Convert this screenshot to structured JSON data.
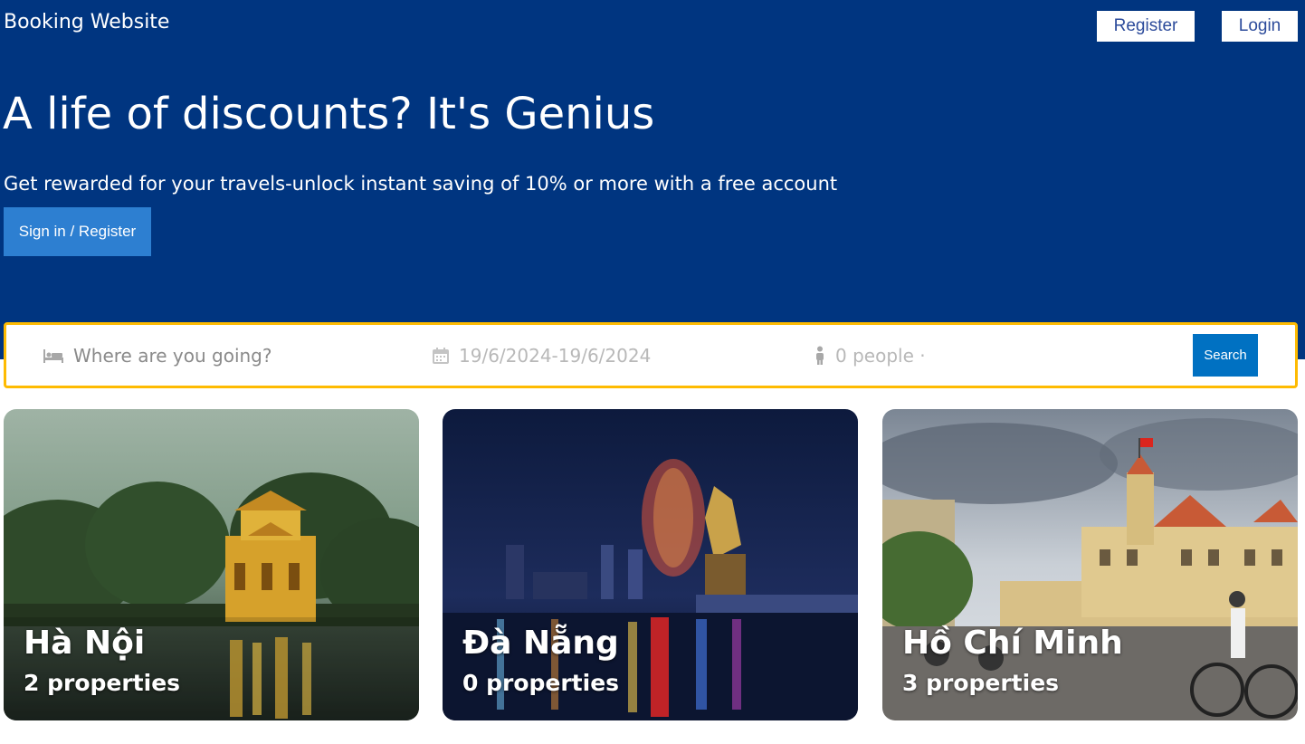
{
  "header": {
    "brand": "Booking Website",
    "register_label": "Register",
    "login_label": "Login"
  },
  "hero": {
    "title": "A life of discounts? It's Genius",
    "subtitle": "Get rewarded for your travels-unlock instant saving of 10% or more with a free account",
    "cta_label": "Sign in / Register"
  },
  "search": {
    "destination_placeholder": "Where are you going?",
    "date_range": "19/6/2024-19/6/2024",
    "people": "0 people ·",
    "search_label": "Search",
    "icons": {
      "destination": "bed-icon",
      "date": "calendar-icon",
      "people": "person-icon"
    }
  },
  "destinations": [
    {
      "city": "Hà Nội",
      "properties": "2 properties"
    },
    {
      "city": "Đà Nẵng",
      "properties": "0 properties"
    },
    {
      "city": "Hồ Chí Minh",
      "properties": "3 properties"
    }
  ],
  "colors": {
    "hero_bg": "#003580",
    "search_border": "#febb02",
    "search_button": "#0071c2",
    "cta_button": "#2d7fd1",
    "nav_text": "#2c4b9b"
  }
}
